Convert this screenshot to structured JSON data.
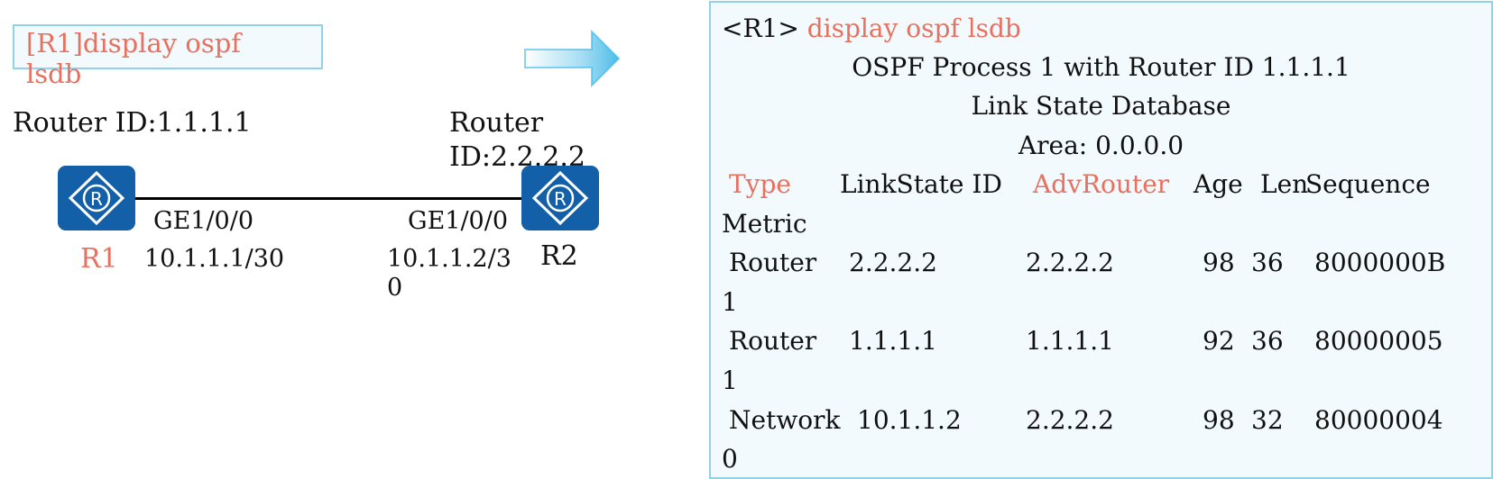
{
  "left": {
    "command": "[R1]display ospf lsdb",
    "r1": {
      "router_id": "Router ID:1.1.1.1",
      "name": "R1",
      "interface": "GE1/0/0",
      "ip": "10.1.1.1/30"
    },
    "r2": {
      "router_id": "Router ID:2.2.2.2",
      "name": "R2",
      "interface": "GE1/0/0",
      "ip": "10.1.1.2/30"
    }
  },
  "output": {
    "prompt": "<R1>",
    "command": "display ospf lsdb",
    "process_line": "OSPF Process 1 with Router ID 1.1.1.1",
    "db_title": "Link State Database",
    "area": "Area: 0.0.0.0",
    "headers": [
      "Type",
      "LinkState ID",
      "AdvRouter",
      "Age",
      "Len",
      "Sequence",
      "Metric"
    ],
    "rows": [
      [
        "Router",
        "2.2.2.2",
        "2.2.2.2",
        "98",
        "36",
        "8000000B",
        "1"
      ],
      [
        "Router",
        "1.1.1.1",
        "1.1.1.1",
        "92",
        "36",
        "80000005",
        "1"
      ],
      [
        "Network",
        "10.1.1.2",
        "2.2.2.2",
        "98",
        "32",
        "80000004",
        "0"
      ]
    ]
  },
  "colors": {
    "highlight": "#e8705f",
    "router_fill": "#1460a8",
    "panel_border": "#8fd3e8",
    "panel_bg": "#f2fafd",
    "arrow": "#3bb6e6"
  },
  "icons": {
    "router": "router-icon",
    "arrow": "arrow-right-icon"
  }
}
